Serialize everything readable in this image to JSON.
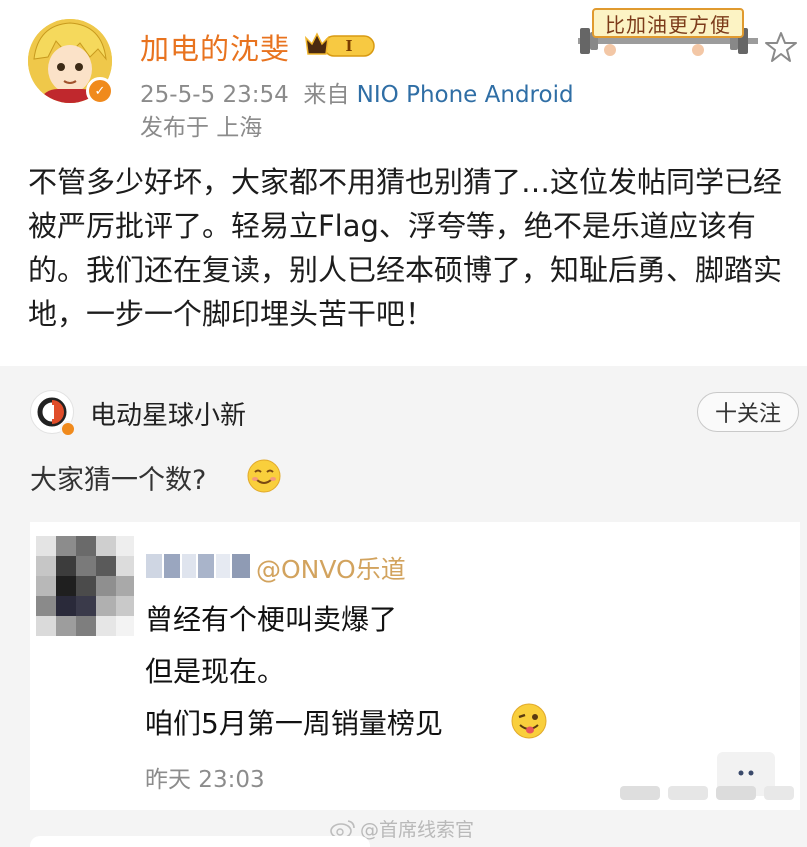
{
  "post": {
    "author": "加电的沈斐",
    "level_badge": "I",
    "timestamp": "25-5-5 23:54",
    "source_prefix": "来自",
    "source_device": "NIO Phone Android",
    "location": "发布于 上海",
    "promo_text": "比加油更方便",
    "text": "不管多少好坏，大家都不用猜也别猜了…这位发帖同学已经被严厉批评了。轻易立Flag、浮夸等，绝不是乐道应该有的。我们还在复读，别人已经本硕博了，知耻后勇、脚踏实地，一步一个脚印埋头苦干吧！"
  },
  "repost": {
    "author": "电动星球小新",
    "follow_label": "十关注",
    "text": "大家猜一个数?",
    "screenshot": {
      "mention": "@ONVO乐道",
      "lines": [
        "曾经有个梗叫卖爆了",
        "但是现在。",
        "咱们5月第一周销量榜见"
      ],
      "time": "昨天 23:03"
    }
  },
  "watermark": "@首席线索官",
  "colors": {
    "username": "#e8731f",
    "link": "#2f6ea5",
    "verified": "#f08a1c",
    "mention": "#d2a35e"
  }
}
